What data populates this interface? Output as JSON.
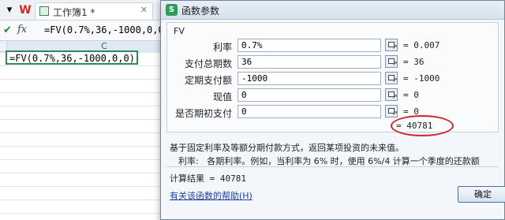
{
  "spreadsheet": {
    "tab_title": "工作簿1 *",
    "formula_bar_text": "=FV(0.7%,36,-1000,0,0",
    "fx_label": "fx",
    "column_header": "C",
    "active_cell_text": "=FV(0.7%,36,-1000,0,0)"
  },
  "dialog": {
    "app_icon_glyph": "S",
    "title": "函数参数",
    "function_name": "FV",
    "params": [
      {
        "label": "利率",
        "value": "0.7%",
        "result": "= 0.007"
      },
      {
        "label": "支付总期数",
        "value": "36",
        "result": "= 36"
      },
      {
        "label": "定期支付额",
        "value": "-1000",
        "result": "= -1000"
      },
      {
        "label": "现值",
        "value": "0",
        "result": "= 0"
      },
      {
        "label": "是否期初支付",
        "value": "0",
        "result": "= 0"
      }
    ],
    "formula_result": "= 40781",
    "description": "基于固定利率及等额分期付款方式，返回某项投资的未来值。",
    "param_help_name": "利率:",
    "param_help_text": "各期利率。例如，当利率为 6% 时，使用 6%/4 计算一个季度的还款额",
    "calc_result": "计算结果 = 40781",
    "help_link": "有关该函数的帮助(H)",
    "ok_button": "确定"
  },
  "colors": {
    "highlight_oval": "#d2232a",
    "active_cell_border": "#2e8b57",
    "link": "#1a3fa8"
  }
}
